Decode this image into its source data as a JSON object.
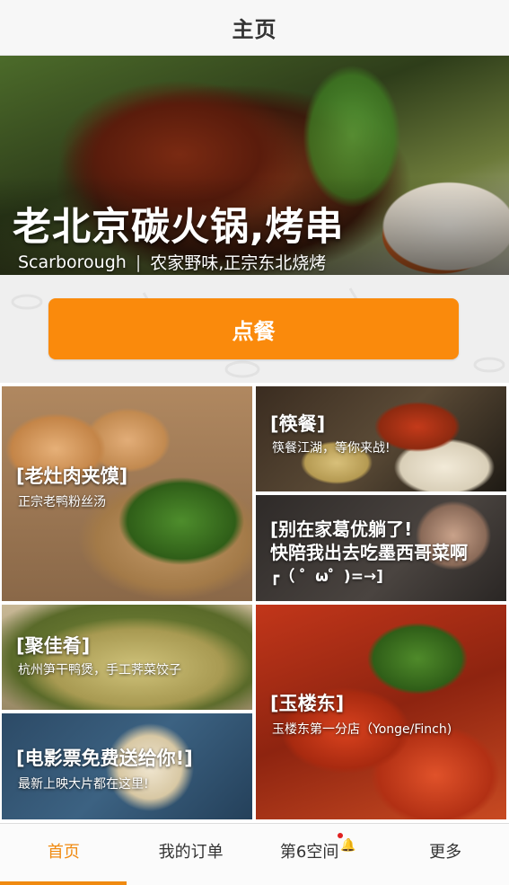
{
  "nav": {
    "title": "主页"
  },
  "hero": {
    "title": "老北京碳火锅,烤串",
    "location": "Scarborough",
    "separator": "|",
    "description": "农家野味,正宗东北烧烤"
  },
  "order_button": {
    "label": "点餐"
  },
  "tiles": [
    {
      "id": "laozao",
      "title": "[老灶肉夹馍]",
      "subtitle": "正宗老鸭粉丝汤"
    },
    {
      "id": "kuaican",
      "title": "[筷餐]",
      "subtitle": "筷餐江湖，等你来战!"
    },
    {
      "id": "mexican",
      "title_line1": "[别在家葛优躺了!",
      "title_line2": "快陪我出去吃墨西哥菜啊",
      "title_line3": "┏（ ゜ω゜)=→]"
    },
    {
      "id": "jujia",
      "title": "[聚佳肴]",
      "subtitle": "杭州笋干鸭煲，手工荠菜饺子"
    },
    {
      "id": "yulou",
      "title": "[玉楼东]",
      "subtitle": "玉楼东第一分店（Yonge/Finch)"
    },
    {
      "id": "movie",
      "title": "[电影票免费送给你!]",
      "subtitle": "最新上映大片都在这里!"
    }
  ],
  "tabbar": {
    "items": [
      {
        "label": "首页",
        "active": true
      },
      {
        "label": "我的订单",
        "active": false
      },
      {
        "label": "第6空间",
        "active": false,
        "icon": "bell-icon",
        "badge": true
      },
      {
        "label": "更多",
        "active": false
      }
    ],
    "accent": "#f08a10"
  },
  "colors": {
    "order_button": "#fa8a0c",
    "badge": "#e02020"
  }
}
